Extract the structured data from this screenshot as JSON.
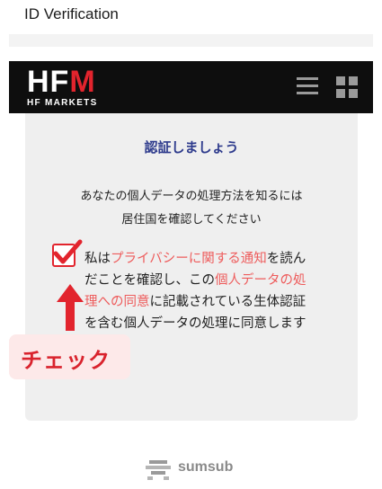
{
  "header": {
    "title": "ID Verification"
  },
  "brand": {
    "logo_text_hf": "HF",
    "logo_text_m": "M",
    "logo_subtitle": "HF MARKETS",
    "menu_icon": "hamburger-menu-icon",
    "apps_icon": "grid-apps-icon"
  },
  "card": {
    "title": "認証しましょう",
    "description_line1": "あなたの個人データの処理方法を知るには",
    "description_line2": "居住国を確認してください",
    "consent": {
      "checked": true,
      "part1": "私は",
      "link1": "プライバシーに関する通知",
      "part2": "を読んだことを確認し、この",
      "link2": "個人データの処理への同意",
      "part3": "に記載されている生体認証を含む個人データの処理に同意します"
    }
  },
  "annotation": {
    "label": "チェック",
    "color": "#d9232d"
  },
  "footer": {
    "powered_by": "sumsub",
    "icon": "sumsub-logo-icon"
  },
  "colors": {
    "brand_red": "#e2242d",
    "link_red": "#ee5c5c",
    "title_blue": "#2d3a8c",
    "bar_black": "#0e0e0e"
  }
}
